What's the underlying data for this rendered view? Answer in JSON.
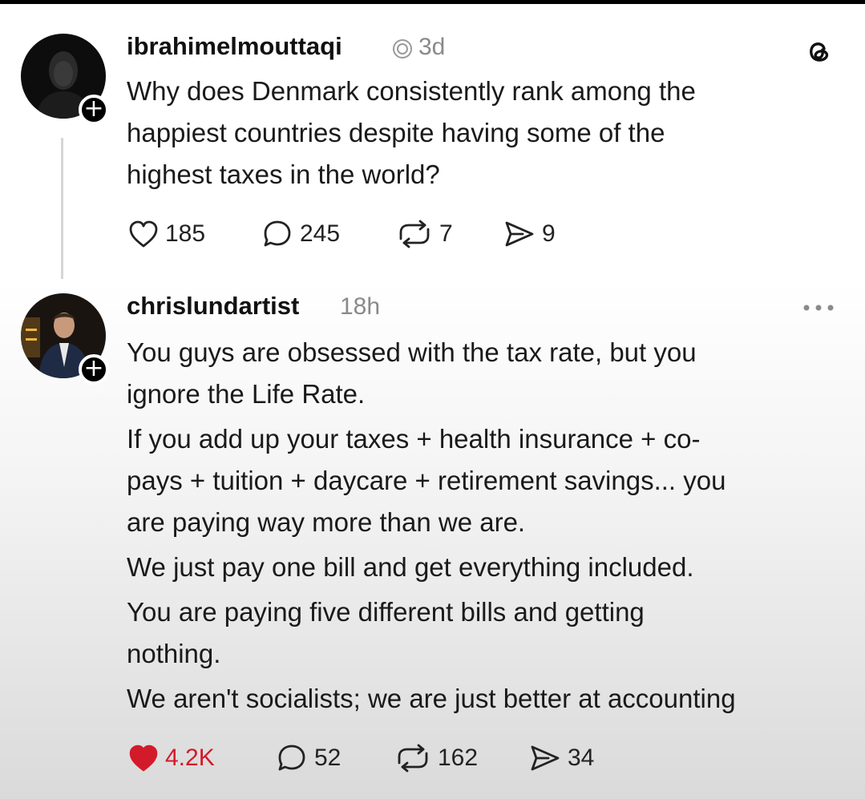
{
  "posts": [
    {
      "username": "ibrahimelmouttaqi",
      "time": "3d",
      "paragraphs": [
        "Why does Denmark consistently rank among the",
        "happiest countries despite having some of the",
        "highest taxes in the world?"
      ],
      "stats": {
        "likes": "185",
        "comments": "245",
        "reposts": "7",
        "shares": "9"
      }
    },
    {
      "username": "chrislundartist",
      "time": "18h",
      "paragraphs": [
        "You guys are obsessed with the tax rate, but you",
        "ignore the Life Rate.",
        "If you add up your taxes + health insurance + co-",
        "pays + tuition + daycare + retirement savings... you",
        "are paying way more than we are.",
        "We just pay one bill and get everything included.",
        "You are paying five different bills and getting",
        "nothing.",
        "We aren't socialists; we are just better at accounting"
      ],
      "stats": {
        "likes": "4.2K",
        "comments": "52",
        "reposts": "162",
        "shares": "34"
      }
    }
  ],
  "colors": {
    "like_active": "#d31a2a",
    "muted_text": "#8a8a8a",
    "thread_line": "#d6d6d6"
  },
  "icons": {
    "brand": "threads-logo-icon",
    "verified": "verified-badge-icon",
    "more": "more-options-icon",
    "like": "heart-icon",
    "comment": "comment-icon",
    "repost": "repost-icon",
    "share": "share-icon",
    "follow": "plus-icon"
  }
}
